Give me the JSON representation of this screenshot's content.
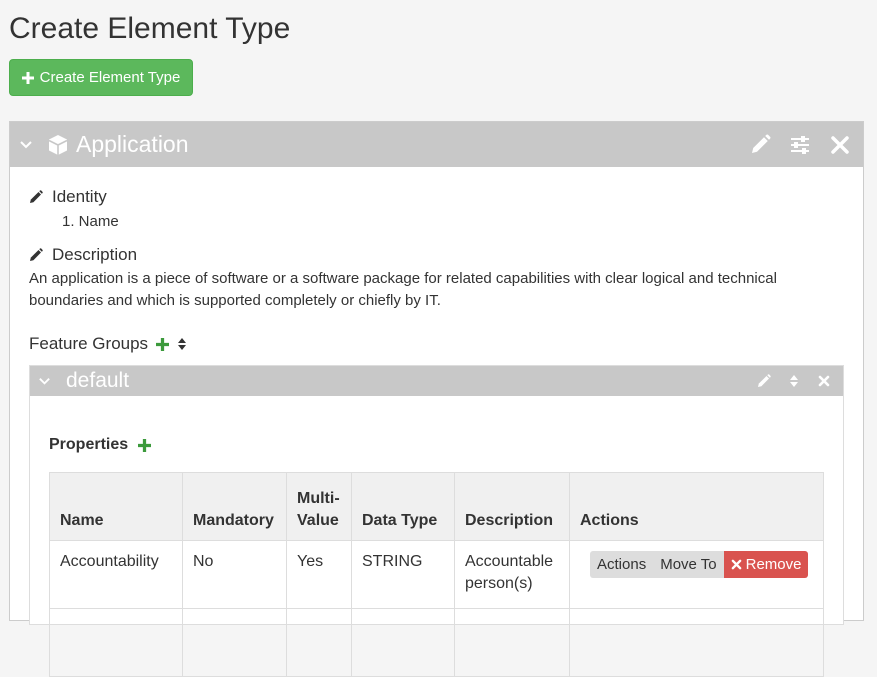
{
  "page": {
    "title": "Create Element Type"
  },
  "toolbar": {
    "create_label": "Create Element Type"
  },
  "element": {
    "title": "Application",
    "identity_label": "Identity",
    "identity_items": [
      "1. Name"
    ],
    "description_label": "Description",
    "description_text": "An application is a piece of software or a software package for related capabilities with clear logical and technical boundaries and which is supported completely or chiefly by IT.",
    "feature_groups_label": "Feature Groups"
  },
  "group": {
    "title": "default",
    "properties_label": "Properties",
    "columns": [
      "Name",
      "Mandatory",
      "Multi-\nValue",
      "Data Type",
      "Description",
      "Actions"
    ],
    "rows": [
      {
        "name": "Accountability",
        "mandatory": "No",
        "multi": "Yes",
        "type": "STRING",
        "description": "Accountable person(s)"
      }
    ],
    "row_actions": {
      "actions": "Actions",
      "move": "Move To",
      "remove": "Remove"
    }
  },
  "colors": {
    "success": "#5cb85c",
    "danger": "#d9534f",
    "header": "#c8c8c8"
  }
}
